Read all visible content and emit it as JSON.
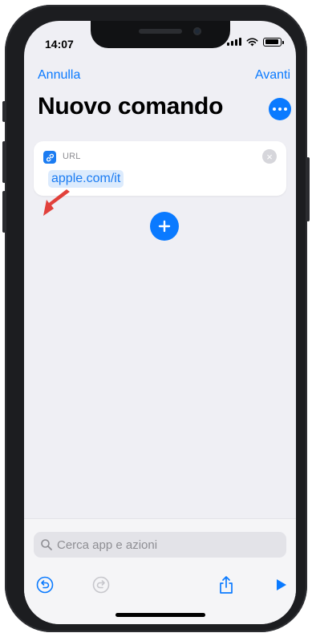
{
  "status_bar": {
    "time": "14:07",
    "battery_level": 0.9
  },
  "nav": {
    "cancel_label": "Annulla",
    "next_label": "Avanti"
  },
  "header": {
    "title": "Nuovo comando"
  },
  "action_card": {
    "label": "URL",
    "url_value": "apple.com/it"
  },
  "bottom": {
    "search_placeholder": "Cerca app e azioni"
  },
  "colors": {
    "accent": "#0a7aff",
    "background": "#efeff4",
    "annotation_arrow": "#e0312a"
  },
  "icons": [
    "more-icon",
    "link-icon",
    "clear-icon",
    "red-arrow-annotation",
    "add-icon",
    "search-icon",
    "undo-icon",
    "redo-icon",
    "share-icon",
    "play-icon"
  ]
}
